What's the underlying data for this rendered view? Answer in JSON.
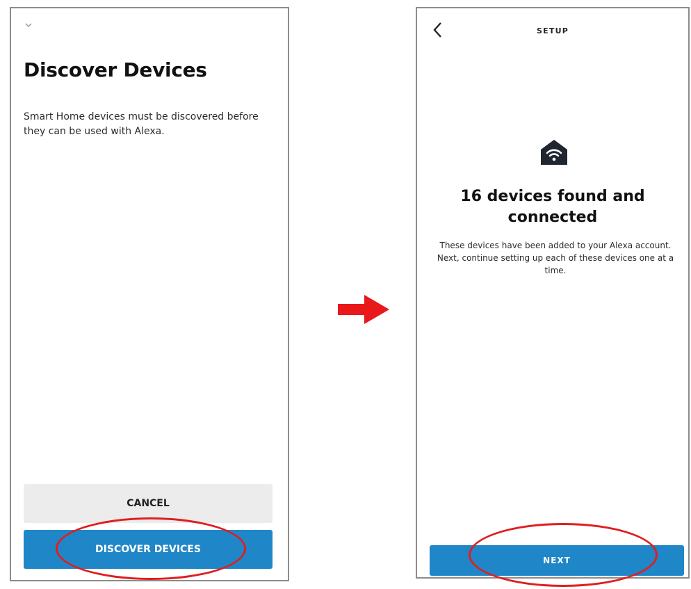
{
  "discover_screen": {
    "title": "Discover Devices",
    "description": "Smart Home devices must be discovered before they can be used with Alexa.",
    "cancel_label": "CANCEL",
    "discover_label": "DISCOVER DEVICES",
    "collapse_icon": "chevron-down-icon"
  },
  "setup_screen": {
    "header_title": "SETUP",
    "back_icon": "chevron-left-icon",
    "status_icon": "home-wifi-icon",
    "found_title": "16 devices found and connected",
    "found_description": "These devices have been added to your Alexa account. Next, continue setting up each of these devices one at a time.",
    "next_label": "NEXT"
  },
  "annotations": {
    "arrow_icon": "right-arrow-icon",
    "highlight_color": "#e01e1e"
  },
  "colors": {
    "primary_button": "#1f86c8",
    "secondary_button": "#ececec",
    "text": "#111111"
  }
}
